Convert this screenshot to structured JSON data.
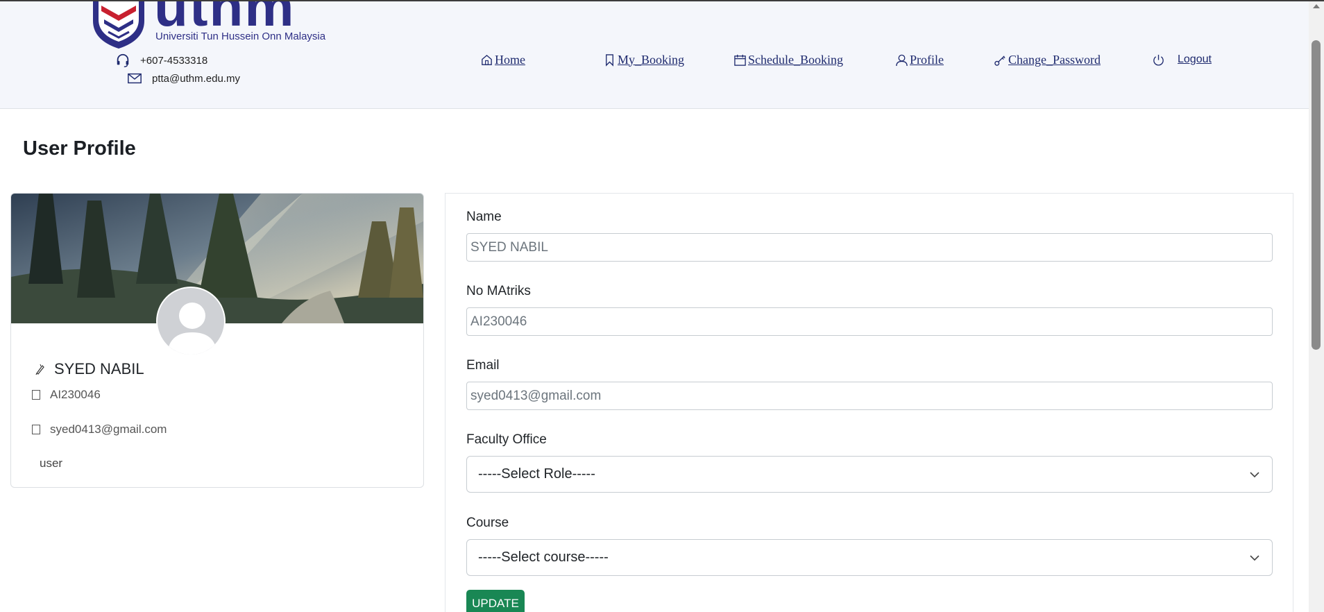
{
  "header": {
    "logo_word": "uthm",
    "logo_subtitle": "Universiti Tun Hussein Onn Malaysia",
    "phone": "+607-4533318",
    "email": "ptta@uthm.edu.my"
  },
  "nav": {
    "home": "Home",
    "my_booking": "My_Booking",
    "schedule_booking": "Schedule_Booking",
    "profile": "Profile",
    "change_password": "Change_Password",
    "logout": "Logout"
  },
  "page": {
    "title": "User Profile"
  },
  "profile_card": {
    "name": "SYED NABIL",
    "matric": "AI230046",
    "email": "syed0413@gmail.com",
    "role": "user"
  },
  "form": {
    "name_label": "Name",
    "name_value": "SYED NABIL",
    "matric_label": "No MAtriks",
    "matric_value": "AI230046",
    "email_label": "Email",
    "email_value": "syed0413@gmail.com",
    "faculty_label": "Faculty Office",
    "faculty_selected": "-----Select Role-----",
    "course_label": "Course",
    "course_selected": "-----Select course-----",
    "update_label": "UPDATE"
  },
  "colors": {
    "brand_navy": "#2e2f86",
    "nav_text": "#1e2a6e",
    "update_green": "#198754",
    "header_bg": "#f4f6fb"
  }
}
